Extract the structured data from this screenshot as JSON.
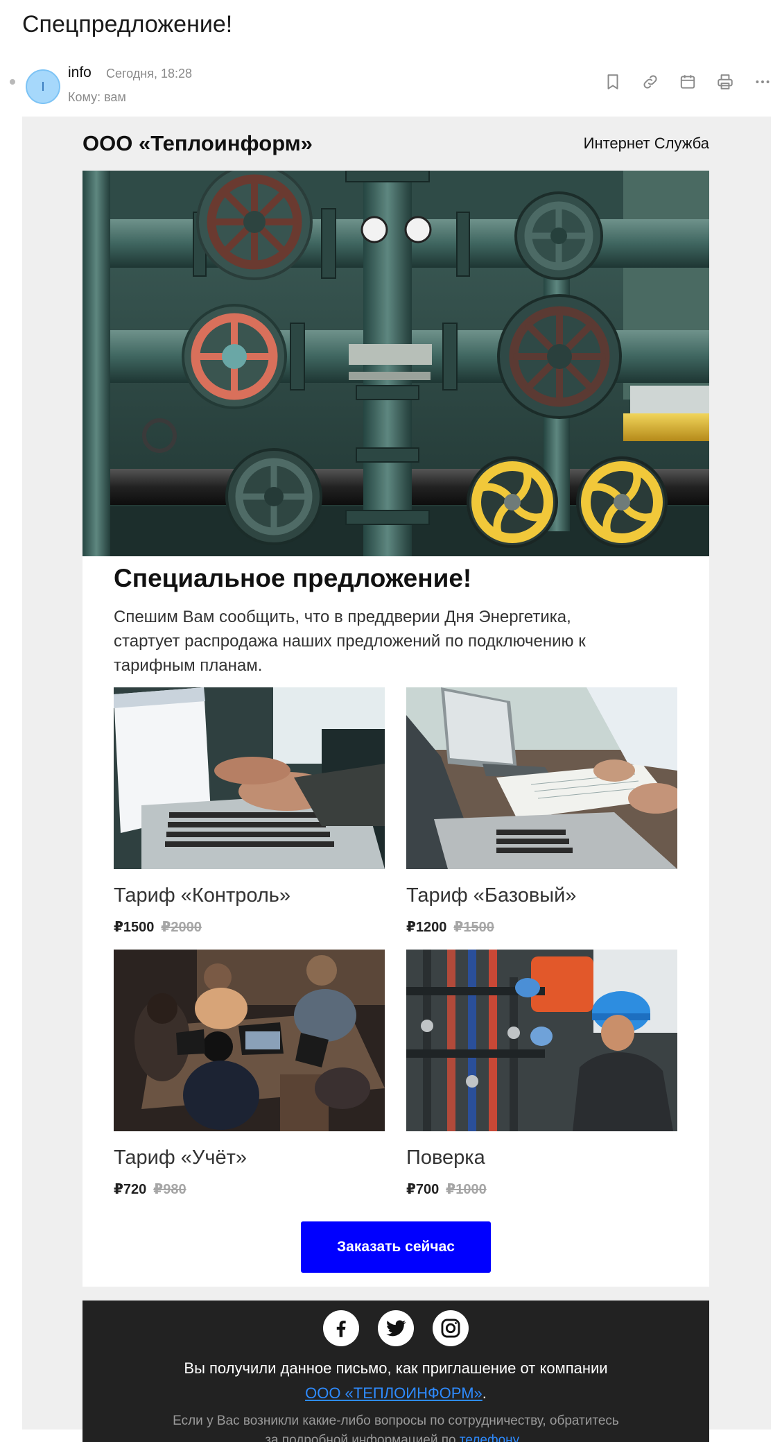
{
  "mail": {
    "subject": "Спецпредложение!",
    "avatar_letter": "I",
    "sender": "info",
    "date": "Сегодня, 18:28",
    "to": "Кому: вам",
    "toolbar_icons": [
      "bookmark-icon",
      "link-icon",
      "calendar-icon",
      "print-icon",
      "more-icon"
    ]
  },
  "email": {
    "brand": "ООО «Теплоинформ»",
    "brand_link": "Интернет Служба",
    "headline": "Специальное предложение!",
    "intro": "Спешим Вам сообщить, что в преддверии Дня Энергетика, стартует распродажа наших предложений по подключению к тарифным планам.",
    "cards": [
      {
        "title": "Тариф «Контроль»",
        "price": "₽1500",
        "old_price": "₽2000"
      },
      {
        "title": "Тариф «Базовый»",
        "price": "₽1200",
        "old_price": "₽1500"
      },
      {
        "title": "Тариф «Учёт»",
        "price": "₽720",
        "old_price": "₽980"
      },
      {
        "title": "Поверка",
        "price": "₽700",
        "old_price": "₽1000"
      }
    ],
    "cta": "Заказать сейчас",
    "footer": {
      "line1": "Вы получили данное письмо, как приглашение от компании",
      "company_link": "ООО «ТЕПЛОИНФОРМ»",
      "line1_end": ".",
      "line2": "Если у Вас возникли какие-либо вопросы по сотрудничеству, обратитесь",
      "line3": "за подробной информацией по",
      "phone_link": "телефону ",
      "line3_end": "."
    }
  },
  "colors": {
    "accent": "#0000ff",
    "footer_bg": "#222222",
    "link": "#2e8bff"
  }
}
